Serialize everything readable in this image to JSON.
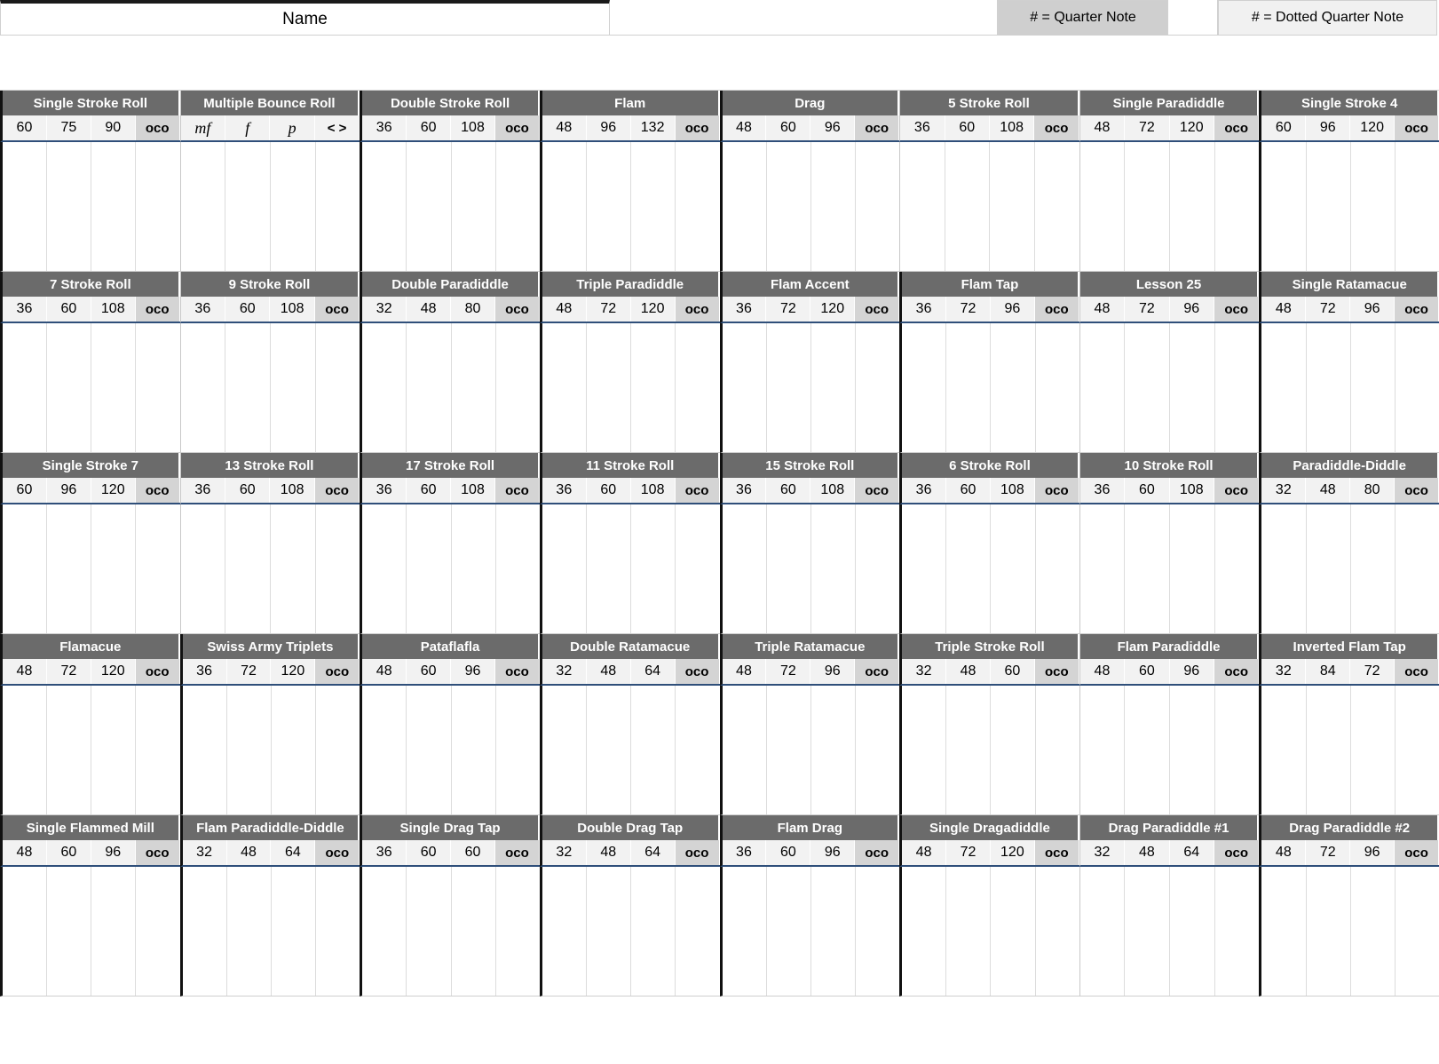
{
  "header": {
    "name_label": "Name",
    "legend_quarter": "# = Quarter Note",
    "legend_dotted": "# = Dotted Quarter Note"
  },
  "oco_label": "oco",
  "rows": [
    {
      "rudiments": [
        {
          "name": "Single Stroke Roll",
          "cells": [
            "60",
            "75",
            "90",
            "oco"
          ],
          "sep": "thick"
        },
        {
          "name": "Multiple Bounce Roll",
          "cells": [
            "mf",
            "f",
            "p",
            "< >"
          ],
          "sep": "light",
          "dynamics": true
        },
        {
          "name": "Double Stroke Roll",
          "cells": [
            "36",
            "60",
            "108",
            "oco"
          ],
          "sep": "thick"
        },
        {
          "name": "Flam",
          "cells": [
            "48",
            "96",
            "132",
            "oco"
          ],
          "sep": "thick"
        },
        {
          "name": "Drag",
          "cells": [
            "48",
            "60",
            "96",
            "oco"
          ],
          "sep": "thick"
        },
        {
          "name": "5 Stroke Roll",
          "cells": [
            "36",
            "60",
            "108",
            "oco"
          ],
          "sep": "light"
        },
        {
          "name": "Single Paradiddle",
          "cells": [
            "48",
            "72",
            "120",
            "oco"
          ],
          "sep": "light"
        },
        {
          "name": "Single Stroke 4",
          "cells": [
            "60",
            "96",
            "120",
            "oco"
          ],
          "sep": "thick"
        }
      ]
    },
    {
      "rudiments": [
        {
          "name": "7 Stroke Roll",
          "cells": [
            "36",
            "60",
            "108",
            "oco"
          ],
          "sep": "thick"
        },
        {
          "name": "9 Stroke Roll",
          "cells": [
            "36",
            "60",
            "108",
            "oco"
          ],
          "sep": "light"
        },
        {
          "name": "Double Paradiddle",
          "cells": [
            "32",
            "48",
            "80",
            "oco"
          ],
          "sep": "thick"
        },
        {
          "name": "Triple Paradiddle",
          "cells": [
            "48",
            "72",
            "120",
            "oco"
          ],
          "sep": "thick"
        },
        {
          "name": "Flam Accent",
          "cells": [
            "36",
            "72",
            "120",
            "oco"
          ],
          "sep": "thick"
        },
        {
          "name": "Flam Tap",
          "cells": [
            "36",
            "72",
            "96",
            "oco"
          ],
          "sep": "thick"
        },
        {
          "name": "Lesson 25",
          "cells": [
            "48",
            "72",
            "96",
            "oco"
          ],
          "sep": "light"
        },
        {
          "name": "Single Ratamacue",
          "cells": [
            "48",
            "72",
            "96",
            "oco"
          ],
          "sep": "thick"
        }
      ]
    },
    {
      "rudiments": [
        {
          "name": "Single Stroke 7",
          "cells": [
            "60",
            "96",
            "120",
            "oco"
          ],
          "sep": "thick"
        },
        {
          "name": "13 Stroke Roll",
          "cells": [
            "36",
            "60",
            "108",
            "oco"
          ],
          "sep": "light"
        },
        {
          "name": "17 Stroke Roll",
          "cells": [
            "36",
            "60",
            "108",
            "oco"
          ],
          "sep": "thick"
        },
        {
          "name": "11 Stroke Roll",
          "cells": [
            "36",
            "60",
            "108",
            "oco"
          ],
          "sep": "thick"
        },
        {
          "name": "15 Stroke Roll",
          "cells": [
            "36",
            "60",
            "108",
            "oco"
          ],
          "sep": "thick"
        },
        {
          "name": "6 Stroke Roll",
          "cells": [
            "36",
            "60",
            "108",
            "oco"
          ],
          "sep": "thick"
        },
        {
          "name": "10 Stroke Roll",
          "cells": [
            "36",
            "60",
            "108",
            "oco"
          ],
          "sep": "light"
        },
        {
          "name": "Paradiddle-Diddle",
          "cells": [
            "32",
            "48",
            "80",
            "oco"
          ],
          "sep": "thick"
        }
      ]
    },
    {
      "rudiments": [
        {
          "name": "Flamacue",
          "cells": [
            "48",
            "72",
            "120",
            "oco"
          ],
          "sep": "thick"
        },
        {
          "name": "Swiss Army Triplets",
          "cells": [
            "36",
            "72",
            "120",
            "oco"
          ],
          "sep": "thick"
        },
        {
          "name": "Pataflafla",
          "cells": [
            "48",
            "60",
            "96",
            "oco"
          ],
          "sep": "thick"
        },
        {
          "name": "Double Ratamacue",
          "cells": [
            "32",
            "48",
            "64",
            "oco"
          ],
          "sep": "thick"
        },
        {
          "name": "Triple Ratamacue",
          "cells": [
            "48",
            "72",
            "96",
            "oco"
          ],
          "sep": "thick"
        },
        {
          "name": "Triple Stroke Roll",
          "cells": [
            "32",
            "48",
            "60",
            "oco"
          ],
          "sep": "thick"
        },
        {
          "name": "Flam Paradiddle",
          "cells": [
            "48",
            "60",
            "96",
            "oco"
          ],
          "sep": "light"
        },
        {
          "name": "Inverted Flam Tap",
          "cells": [
            "32",
            "84",
            "72",
            "oco"
          ],
          "sep": "thick"
        }
      ]
    },
    {
      "rudiments": [
        {
          "name": "Single Flammed Mill",
          "cells": [
            "48",
            "60",
            "96",
            "oco"
          ],
          "sep": "thick"
        },
        {
          "name": "Flam Paradiddle-Diddle",
          "cells": [
            "32",
            "48",
            "64",
            "oco"
          ],
          "sep": "thick"
        },
        {
          "name": "Single Drag Tap",
          "cells": [
            "36",
            "60",
            "60",
            "oco"
          ],
          "sep": "thick"
        },
        {
          "name": "Double Drag Tap",
          "cells": [
            "32",
            "48",
            "64",
            "oco"
          ],
          "sep": "thick"
        },
        {
          "name": "Flam Drag",
          "cells": [
            "36",
            "60",
            "96",
            "oco"
          ],
          "sep": "thick"
        },
        {
          "name": "Single Dragadiddle",
          "cells": [
            "48",
            "72",
            "120",
            "oco"
          ],
          "sep": "thick"
        },
        {
          "name": "Drag Paradiddle #1",
          "cells": [
            "32",
            "48",
            "64",
            "oco"
          ],
          "sep": "light"
        },
        {
          "name": "Drag Paradiddle #2",
          "cells": [
            "48",
            "72",
            "96",
            "oco"
          ],
          "sep": "thick"
        }
      ]
    }
  ],
  "colors": {
    "title_bg": "#6b6b6b",
    "tempo_bg": "#f2f2f2",
    "oco_bg": "#d4d4d4",
    "rule": "#2f4f7a",
    "legend_quarter_bg": "#cfcfcf",
    "legend_dotted_bg": "#f1f1f1"
  }
}
